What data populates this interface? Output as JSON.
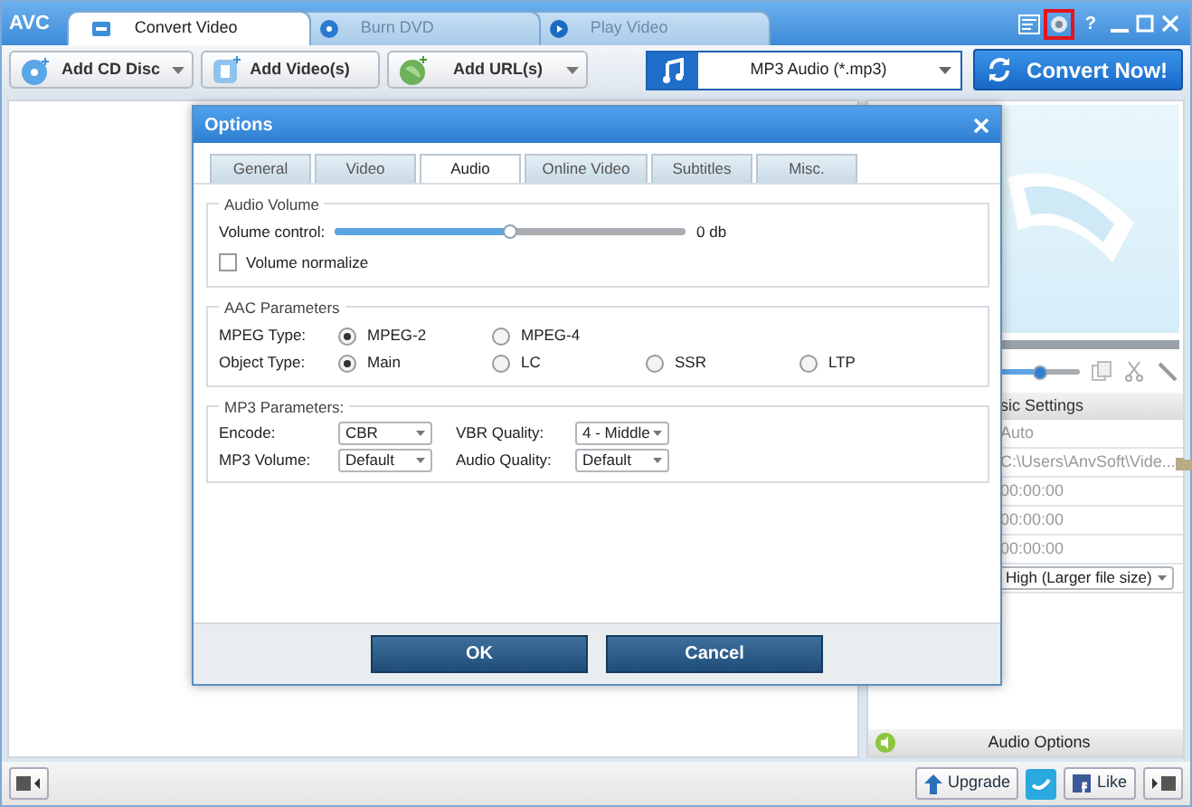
{
  "app": {
    "logo": "AVC",
    "help": "?",
    "settings_highlighted": true
  },
  "tabs": [
    {
      "label": "Convert Video",
      "selected": true,
      "kind": "convert"
    },
    {
      "label": "Burn DVD",
      "selected": false,
      "kind": "disc"
    },
    {
      "label": "Play Video",
      "selected": false,
      "kind": "play"
    }
  ],
  "toolbar": {
    "buttons": [
      {
        "label": "Add CD Disc",
        "kind": "disc",
        "dropdown": true
      },
      {
        "label": "Add Video(s)",
        "kind": "video",
        "dropdown": false
      },
      {
        "label": "Add URL(s)",
        "kind": "url",
        "dropdown": true
      }
    ],
    "profile": "MP3 Audio (*.mp3)",
    "convert": "Convert Now!"
  },
  "right_panel": {
    "level": 0.5,
    "settings_header": "sic Settings",
    "settings": [
      {
        "kind": "text",
        "value": "Auto"
      },
      {
        "kind": "path",
        "value": "C:\\Users\\AnvSoft\\Vide..."
      },
      {
        "kind": "text",
        "value": "00:00:00"
      },
      {
        "kind": "text",
        "value": "00:00:00"
      },
      {
        "kind": "text",
        "value": "00:00:00"
      },
      {
        "kind": "select",
        "value": "High (Larger file size)"
      }
    ],
    "audio_options": "Audio Options"
  },
  "status_bar": {
    "upgrade": "Upgrade",
    "like": "Like"
  },
  "dialog": {
    "title": "Options",
    "tabs": [
      {
        "label": "General",
        "selected": false
      },
      {
        "label": "Video",
        "selected": false
      },
      {
        "label": "Audio",
        "selected": true
      },
      {
        "label": "Online Video",
        "selected": false
      },
      {
        "label": "Subtitles",
        "selected": false
      },
      {
        "label": "Misc.",
        "selected": false
      }
    ],
    "audio_volume": {
      "title": "Audio Volume",
      "label": "Volume control:",
      "level": 0.5,
      "reading": "0 db",
      "normalize": {
        "label": "Volume normalize",
        "checked": false
      }
    },
    "aac": {
      "title": "AAC Parameters",
      "rows": [
        {
          "label": "MPEG Type:",
          "options": [
            {
              "label": "MPEG-2",
              "selected": true
            },
            {
              "label": "MPEG-4",
              "selected": false
            }
          ]
        },
        {
          "label": "Object Type:",
          "options": [
            {
              "label": "Main",
              "selected": true
            },
            {
              "label": "LC",
              "selected": false
            },
            {
              "label": "SSR",
              "selected": false
            },
            {
              "label": "LTP",
              "selected": false
            }
          ]
        }
      ]
    },
    "mp3": {
      "title": "MP3 Parameters:",
      "fields": [
        {
          "label": "Encode:",
          "value": "CBR"
        },
        {
          "label": "VBR Quality:",
          "value": "4 - Middle"
        },
        {
          "label": "MP3 Volume:",
          "value": "Default"
        },
        {
          "label": "Audio Quality:",
          "value": "Default"
        }
      ]
    },
    "buttons": [
      "OK",
      "Cancel"
    ]
  }
}
